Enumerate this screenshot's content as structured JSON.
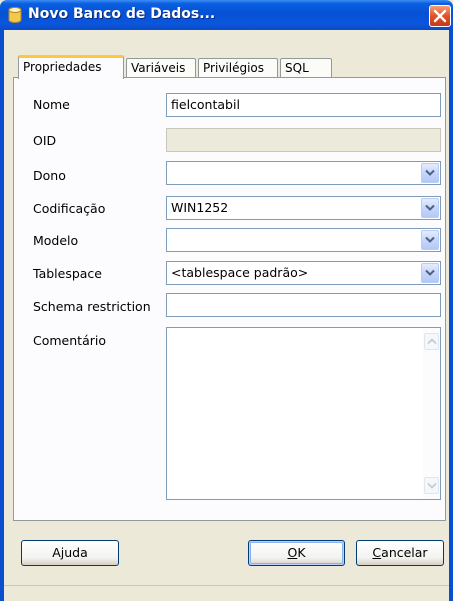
{
  "window": {
    "title": "Novo Banco de Dados..."
  },
  "tabs": [
    {
      "label": "Propriedades",
      "active": true
    },
    {
      "label": "Variáveis",
      "active": false
    },
    {
      "label": "Privilégios",
      "active": false
    },
    {
      "label": "SQL",
      "active": false
    }
  ],
  "form": {
    "name_label": "Nome",
    "name_value": "fielcontabil",
    "oid_label": "OID",
    "oid_value": "",
    "owner_label": "Dono",
    "owner_value": "",
    "encoding_label": "Codificação",
    "encoding_value": "WIN1252",
    "template_label": "Modelo",
    "template_value": "",
    "tablespace_label": "Tablespace",
    "tablespace_value": "<tablespace padrão>",
    "schema_restriction_label": "Schema restriction",
    "schema_restriction_value": "",
    "comment_label": "Comentário",
    "comment_value": ""
  },
  "buttons": {
    "help": "Ajuda",
    "ok": "OK",
    "cancel": "Cancelar",
    "ok_mnemonic": "O",
    "cancel_mnemonic": "C"
  },
  "icons": {
    "title_icon": "database-icon",
    "close_icon": "close-icon",
    "dropdown_icon": "chevron-down-icon"
  },
  "colors": {
    "titlebar": "#0a56dc",
    "close_button": "#e0512a",
    "active_tab_highlight": "#ffc83c",
    "dialog_background": "#ece9d8"
  }
}
